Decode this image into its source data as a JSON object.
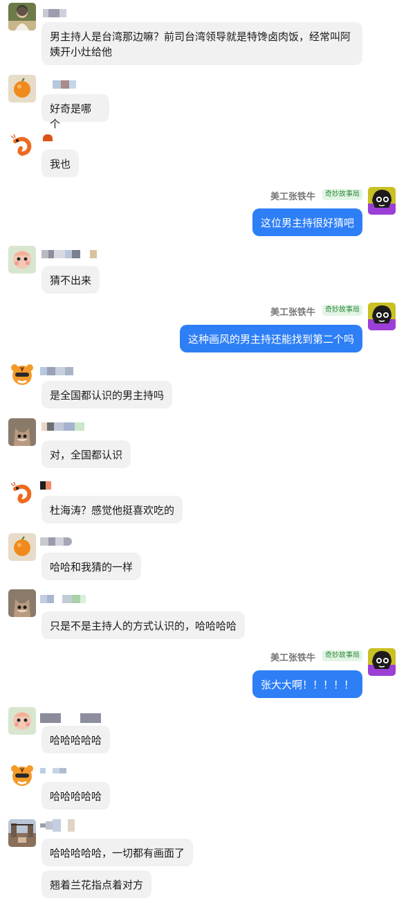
{
  "accent_color": "#2e7ff6",
  "tag_color": "#2f8a3a",
  "messages": [
    {
      "side": "left",
      "avatar": "woman-photo-avatar",
      "lines": [
        "男主持人是台湾那边嘛？前司台湾领导就是特馋卤肉饭，经常叫阿姨开小灶给他"
      ]
    },
    {
      "side": "left",
      "avatar": "orange-fruit-avatar",
      "lines": [
        "好奇是哪个"
      ]
    },
    {
      "side": "left",
      "avatar": "shrimp-avatar",
      "lines": [
        "我也"
      ]
    },
    {
      "side": "right",
      "name": "美工张铁牛",
      "tag": "奇妙故事局",
      "lines": [
        "这位男主持很好猜吧"
      ]
    },
    {
      "side": "left",
      "avatar": "cartoon-baby-avatar",
      "lines": [
        "猜不出来"
      ]
    },
    {
      "side": "right",
      "name": "美工张铁牛",
      "tag": "奇妙故事局",
      "lines": [
        "这种画风的男主持还能找到第二个吗"
      ]
    },
    {
      "side": "left",
      "avatar": "tiger-avatar",
      "lines": [
        "是全国都认识的男主持吗"
      ]
    },
    {
      "side": "left",
      "avatar": "cat-photo-avatar",
      "lines": [
        "对，全国都认识"
      ]
    },
    {
      "side": "left",
      "avatar": "shrimp-avatar",
      "lines": [
        "杜海涛？感觉他挺喜欢吃的"
      ]
    },
    {
      "side": "left",
      "avatar": "orange-fruit-avatar",
      "lines": [
        "哈哈和我猜的一样"
      ]
    },
    {
      "side": "left",
      "avatar": "cat-photo-avatar",
      "lines": [
        "只是不是主持人的方式认识的，哈哈哈哈"
      ]
    },
    {
      "side": "right",
      "name": "美工张铁牛",
      "tag": "奇妙故事局",
      "lines": [
        "张大大啊！！！！！"
      ]
    },
    {
      "side": "left",
      "avatar": "cartoon-baby-avatar",
      "lines": [
        "哈哈哈哈哈"
      ]
    },
    {
      "side": "left",
      "avatar": "tiger-avatar",
      "lines": [
        "哈哈哈哈哈"
      ]
    },
    {
      "side": "left",
      "avatar": "street-photo-avatar",
      "lines": [
        "哈哈哈哈哈，一切都有画面了",
        "翘着兰花指点着对方"
      ]
    }
  ]
}
